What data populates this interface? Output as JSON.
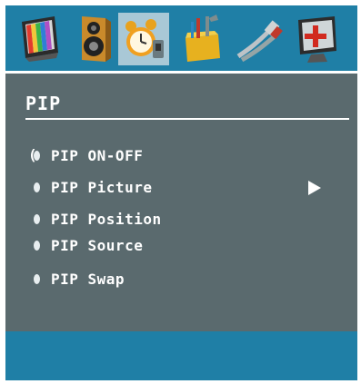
{
  "toolbar": {
    "icons": [
      {
        "name": "picture-menu-icon",
        "selected": false
      },
      {
        "name": "sound-menu-icon",
        "selected": false
      },
      {
        "name": "feature-menu-icon",
        "selected": true
      },
      {
        "name": "install-menu-icon",
        "selected": false
      },
      {
        "name": "source-menu-icon",
        "selected": false
      },
      {
        "name": "pc-menu-icon",
        "selected": false
      }
    ]
  },
  "menu": {
    "title": "PIP",
    "items": [
      {
        "label": "PIP ON-OFF",
        "focused": true
      },
      {
        "label": "PIP Picture",
        "has_submenu": true
      },
      {
        "label": "PIP Position"
      },
      {
        "label": "PIP Source"
      },
      {
        "label": "PIP Swap"
      }
    ]
  },
  "colors": {
    "panel": "#5a6a6e",
    "bar": "#1f7fa6",
    "selected_icon_bg": "#a9c8d6",
    "text": "#ffffff"
  }
}
